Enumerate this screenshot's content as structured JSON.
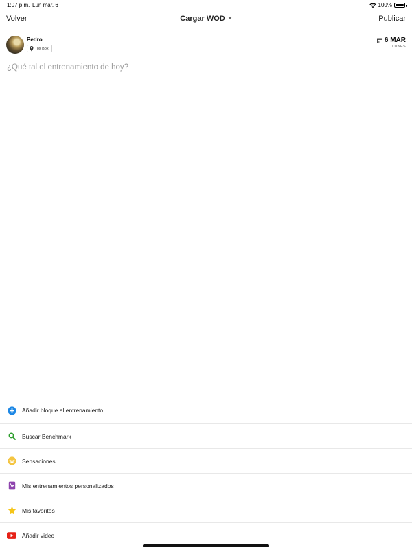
{
  "status_bar": {
    "time": "1:07 p.m.",
    "date": "Lun mar. 6",
    "battery": "100%"
  },
  "nav": {
    "back_label": "Volver",
    "title": "Cargar WOD",
    "publish_label": "Publicar"
  },
  "post": {
    "user_name": "Pedro",
    "location": "Tox Box",
    "date_main": "6 MAR",
    "date_sub": "LUNES",
    "placeholder": "¿Qué tal el entrenamiento de hoy?"
  },
  "actions": [
    {
      "label": "Añadir bloque al entrenamiento",
      "icon": "add-circle-icon",
      "color": "#1e88e5"
    },
    {
      "label": "Buscar Benchmark",
      "icon": "search-icon",
      "color": "#2e9e2e"
    },
    {
      "label": "Sensaciones",
      "icon": "smiley-icon",
      "color": "#f4c542"
    },
    {
      "label": "Mis entrenamientos personalizados",
      "icon": "custom-workout-icon",
      "color": "#8e44ad"
    },
    {
      "label": "Mis favoritos",
      "icon": "star-icon",
      "color": "#f5c518"
    },
    {
      "label": "Añadir video",
      "icon": "youtube-icon",
      "color": "#e62117"
    }
  ]
}
